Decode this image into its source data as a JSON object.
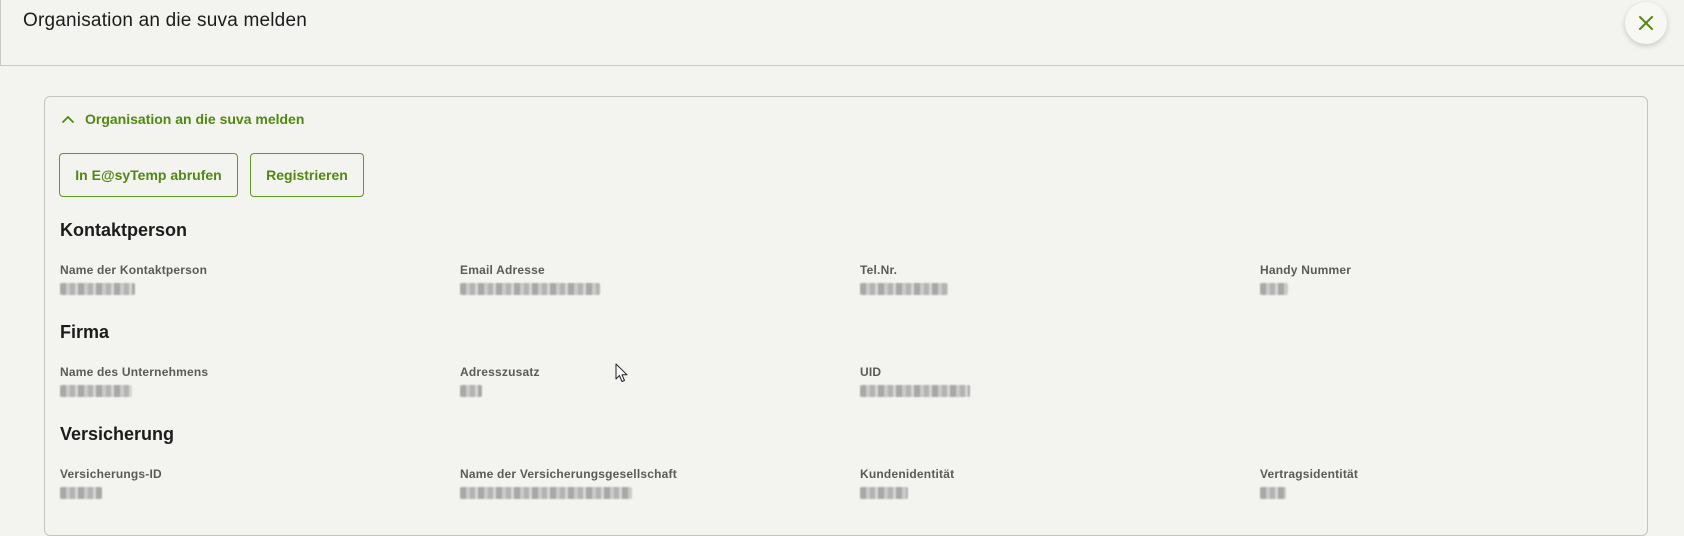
{
  "modal": {
    "title": "Organisation an die suva melden",
    "close_icon": "close-icon",
    "close_label": "Schliessen"
  },
  "panel": {
    "title": "Organisation an die suva melden",
    "toggle_icon": "chevron-up-icon",
    "buttons": {
      "easytemp": "In E@syTemp abrufen",
      "register": "Registrieren"
    }
  },
  "sections": {
    "kontakt": {
      "title": "Kontaktperson",
      "fields": [
        {
          "label": "Name der Kontaktperson",
          "value": ""
        },
        {
          "label": "Email Adresse",
          "value": ""
        },
        {
          "label": "Tel.Nr.",
          "value": ""
        },
        {
          "label": "Handy Nummer",
          "value": ""
        }
      ]
    },
    "firma": {
      "title": "Firma",
      "fields": [
        {
          "label": "Name des Unternehmens",
          "value": ""
        },
        {
          "label": "Adresszusatz",
          "value": ""
        },
        {
          "label": "UID",
          "value": ""
        }
      ]
    },
    "versicherung": {
      "title": "Versicherung",
      "fields": [
        {
          "label": "Versicherungs-ID",
          "value": ""
        },
        {
          "label": "Name der Versicherungsgesellschaft",
          "value": ""
        },
        {
          "label": "Kundenidentität",
          "value": ""
        },
        {
          "label": "Vertragsidentität",
          "value": ""
        }
      ]
    }
  },
  "colors": {
    "accent": "#4f8a10",
    "background": "#f3f3ef",
    "border": "#c4c4bf",
    "text": "#1c1c1c",
    "label": "#5a5a5a"
  }
}
